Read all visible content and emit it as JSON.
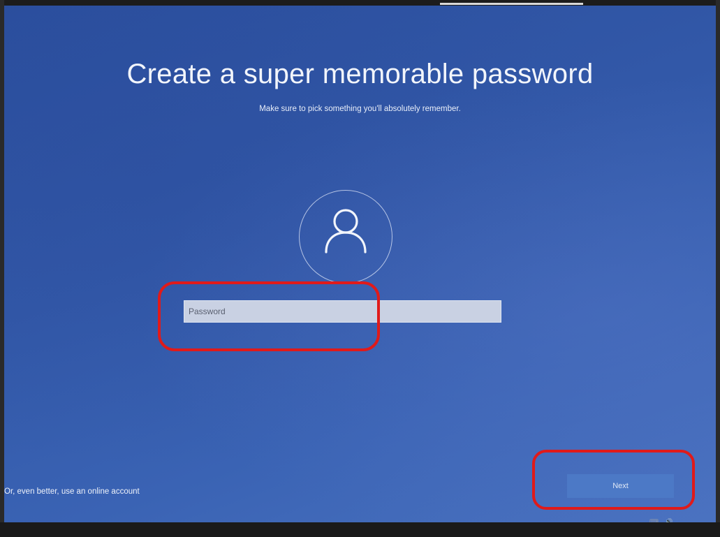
{
  "setup": {
    "title": "Create a super memorable password",
    "subtitle": "Make sure to pick something you'll absolutely remember.",
    "password_placeholder": "Password",
    "online_account_link": "Or, even better, use an online account",
    "next_label": "Next"
  },
  "icons": {
    "avatar": "user-icon",
    "tray_keyboard": "keyboard-icon",
    "tray_volume": "volume-icon",
    "tray_keyboard_glyph": "⌨",
    "tray_volume_glyph": "🔊"
  },
  "colors": {
    "screen_bg": "#3258a8",
    "field_bg": "#c9d1e3",
    "next_button": "#4c79c6",
    "annotation": "#e01a1a"
  }
}
